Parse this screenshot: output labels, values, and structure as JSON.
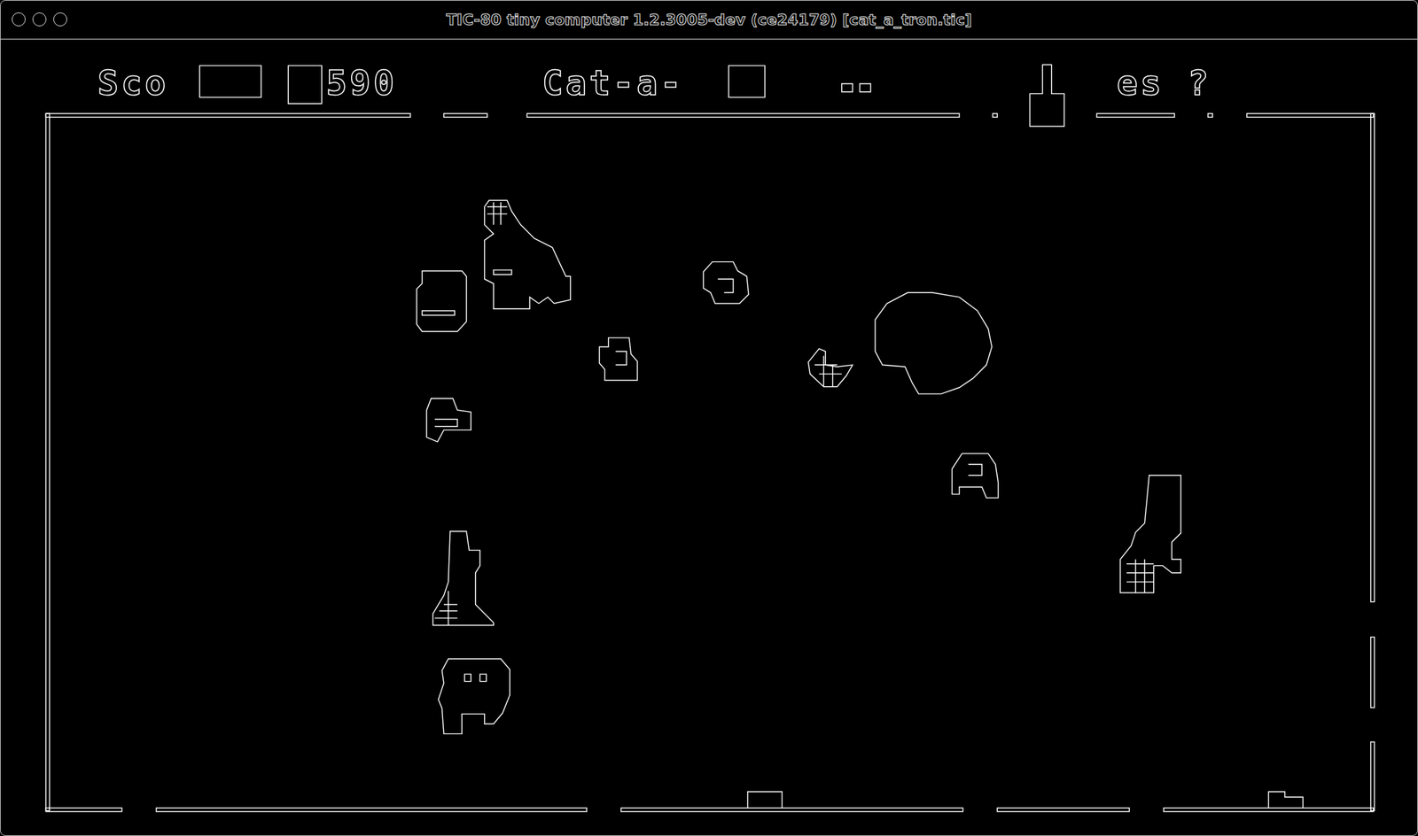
{
  "window": {
    "title": "TIC-80 tiny computer 1.2.3005-dev (ce24179) [cat_a_tron.tic]"
  },
  "hud": [
    {
      "name": "score-label",
      "text": "Sco"
    },
    {
      "name": "score-value",
      "text": "590"
    },
    {
      "name": "game-title",
      "text": "Cat-a-"
    },
    {
      "name": "prompt-text",
      "text": "es ?"
    }
  ]
}
